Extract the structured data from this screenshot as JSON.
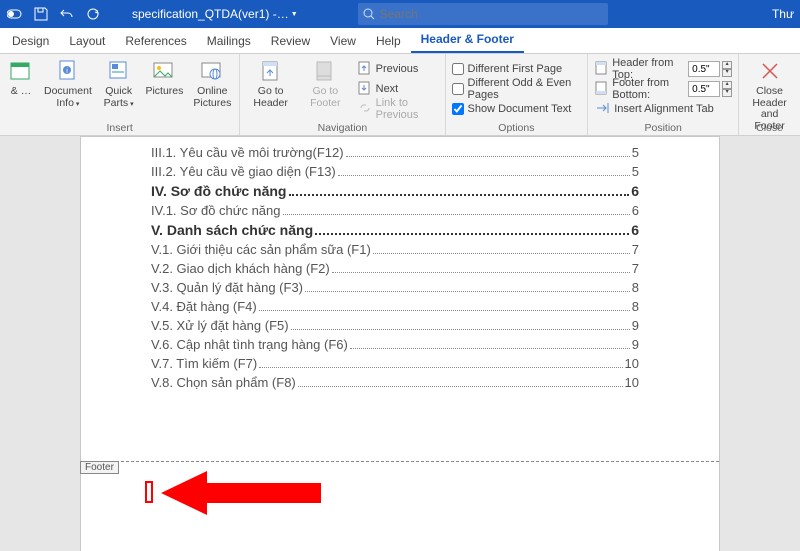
{
  "titlebar": {
    "doc_title": "specification_QTDA(ver1) -…",
    "search_placeholder": "Search",
    "right_text": "Thư"
  },
  "tabs": [
    {
      "label": "Design"
    },
    {
      "label": "Layout"
    },
    {
      "label": "References"
    },
    {
      "label": "Mailings"
    },
    {
      "label": "Review"
    },
    {
      "label": "View"
    },
    {
      "label": "Help"
    },
    {
      "label": "Header & Footer",
      "active": true
    }
  ],
  "ribbon": {
    "insert": {
      "label": "Insert",
      "datetime": "& …",
      "docinfo": "Document Info",
      "quickparts": "Quick Parts",
      "pictures": "Pictures",
      "online": "Online Pictures"
    },
    "nav": {
      "label": "Navigation",
      "gotoheader": "Go to Header",
      "gotofooter": "Go to Footer",
      "previous": "Previous",
      "next": "Next",
      "linkprev": "Link to Previous"
    },
    "options": {
      "label": "Options",
      "diff_first": "Different First Page",
      "diff_odd": "Different Odd & Even Pages",
      "show_doc": "Show Document Text"
    },
    "position": {
      "label": "Position",
      "header_from_top": "Header from Top:",
      "footer_from_bottom": "Footer from Bottom:",
      "header_val": "0.5\"",
      "footer_val": "0.5\"",
      "align_tab": "Insert Alignment Tab"
    },
    "close": {
      "label": "Close",
      "btn": "Close Header and Footer"
    }
  },
  "toc": [
    {
      "left": "III.1. Yêu cầu về môi trường(F12)",
      "page": "5",
      "bold": false
    },
    {
      "left": "III.2. Yêu cầu về giao diện (F13)",
      "page": "5",
      "bold": false
    },
    {
      "left": "IV. Sơ đồ chức năng",
      "page": "6",
      "bold": true
    },
    {
      "left": "IV.1. Sơ đồ chức năng",
      "page": "6",
      "bold": false
    },
    {
      "left": "V. Danh sách chức năng",
      "page": "6",
      "bold": true
    },
    {
      "left": "V.1. Giới thiệu các sản phẩm sữa (F1)",
      "page": "7",
      "bold": false
    },
    {
      "left": "V.2. Giao dịch khách hàng (F2)",
      "page": "7",
      "bold": false
    },
    {
      "left": "V.3. Quản lý đặt hàng (F3)",
      "page": "8",
      "bold": false
    },
    {
      "left": "V.4. Đặt hàng (F4)",
      "page": "8",
      "bold": false
    },
    {
      "left": "V.5. Xử lý đặt hàng (F5)",
      "page": "9",
      "bold": false
    },
    {
      "left": "V.6. Cập nhật tình trạng hàng (F6)",
      "page": "9",
      "bold": false
    },
    {
      "left": "V.7. Tìm kiếm (F7)",
      "page": "10",
      "bold": false
    },
    {
      "left": "V.8. Chọn sản phẩm (F8)",
      "page": "10",
      "bold": false
    }
  ],
  "footer_tag": "Footer"
}
